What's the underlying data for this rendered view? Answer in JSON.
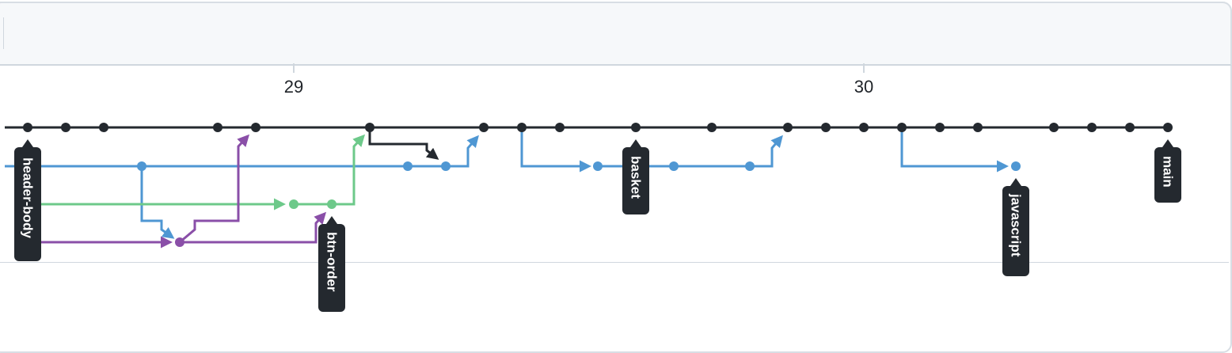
{
  "timeline": {
    "days": [
      "29",
      "30"
    ]
  },
  "branches": {
    "header_body": "header-body",
    "btn_order": "btn-order",
    "basket": "basket",
    "javascript": "javascript",
    "main": "main"
  },
  "colors": {
    "main": "#24292f",
    "blue": "#4f97d3",
    "green": "#6dc98a",
    "purple": "#8a4fa8",
    "label_bg": "#24292f"
  }
}
